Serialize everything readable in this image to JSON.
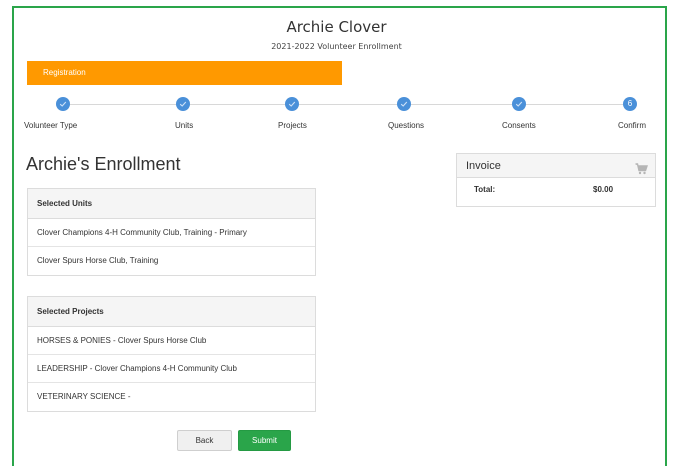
{
  "header": {
    "name": "Archie Clover",
    "subtitle": "2021-2022 Volunteer Enrollment"
  },
  "registration_bar": {
    "label": "Registration",
    "color": "#ff9900"
  },
  "steps": [
    {
      "label": "Volunteer Type",
      "state": "complete"
    },
    {
      "label": "Units",
      "state": "complete"
    },
    {
      "label": "Projects",
      "state": "complete"
    },
    {
      "label": "Questions",
      "state": "complete"
    },
    {
      "label": "Consents",
      "state": "complete"
    },
    {
      "label": "Confirm",
      "state": "current",
      "number": "6"
    }
  ],
  "enrollment_title": "Archie's Enrollment",
  "units_panel": {
    "header": "Selected Units",
    "rows": [
      "Clover Champions 4-H Community Club, Training - Primary",
      "Clover Spurs Horse Club, Training"
    ]
  },
  "projects_panel": {
    "header": "Selected Projects",
    "rows": [
      "HORSES & PONIES - Clover Spurs Horse Club",
      "LEADERSHIP - Clover Champions 4-H Community Club",
      "VETERINARY SCIENCE -"
    ]
  },
  "invoice": {
    "title": "Invoice",
    "icon": "cart-icon",
    "total_label": "Total:",
    "total_value": "$0.00"
  },
  "buttons": {
    "back": "Back",
    "submit": "Submit"
  },
  "colors": {
    "accent_green": "#2aa54a",
    "step_blue": "#4a90d9",
    "orange": "#ff9900"
  }
}
